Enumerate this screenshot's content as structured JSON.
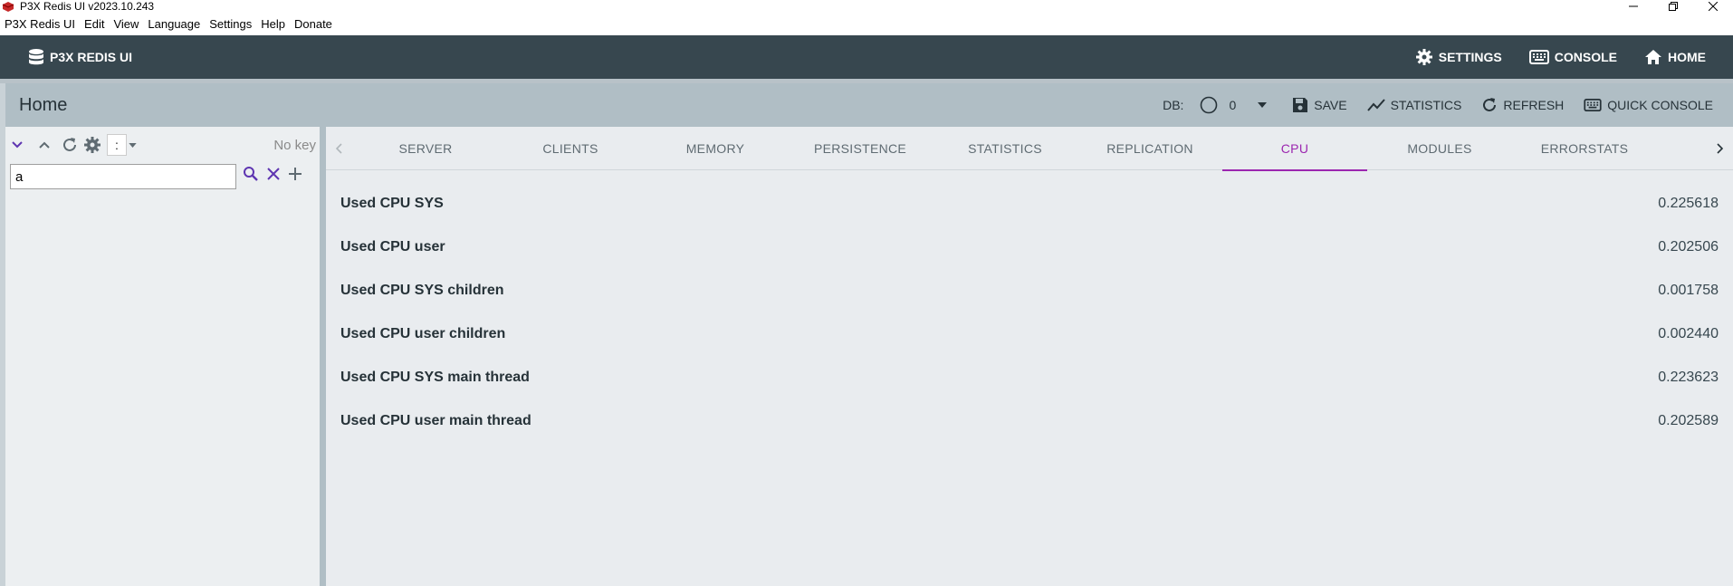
{
  "window": {
    "title": "P3X Redis UI v2023.10.243"
  },
  "menubar": {
    "items": [
      "P3X Redis UI",
      "Edit",
      "View",
      "Language",
      "Settings",
      "Help",
      "Donate"
    ]
  },
  "toolbar": {
    "brand": "P3X REDIS UI",
    "settings_label": "SETTINGS",
    "console_label": "CONSOLE",
    "home_label": "HOME"
  },
  "header": {
    "title": "Home",
    "db_label": "DB:",
    "db_value": "0",
    "save_label": "SAVE",
    "statistics_label": "STATISTICS",
    "refresh_label": "REFRESH",
    "quick_console_label": "QUICK CONSOLE"
  },
  "leftpanel": {
    "separator": ":",
    "no_key_text": "No key",
    "search_value": "a"
  },
  "tabs": {
    "items": [
      "SERVER",
      "CLIENTS",
      "MEMORY",
      "PERSISTENCE",
      "STATISTICS",
      "REPLICATION",
      "CPU",
      "MODULES",
      "ERRORSTATS"
    ],
    "active": "CPU"
  },
  "cpu": {
    "rows": [
      {
        "label": "Used CPU SYS",
        "value": "0.225618"
      },
      {
        "label": "Used CPU user",
        "value": "0.202506"
      },
      {
        "label": "Used CPU SYS children",
        "value": "0.001758"
      },
      {
        "label": "Used CPU user children",
        "value": "0.002440"
      },
      {
        "label": "Used CPU SYS main thread",
        "value": "0.223623"
      },
      {
        "label": "Used CPU user main thread",
        "value": "0.202589"
      }
    ]
  },
  "colors": {
    "toolbar_bg": "#37474f",
    "header_bg": "#b0bec5",
    "accent": "#9c27b0",
    "icon_purple": "#5e35b1"
  }
}
